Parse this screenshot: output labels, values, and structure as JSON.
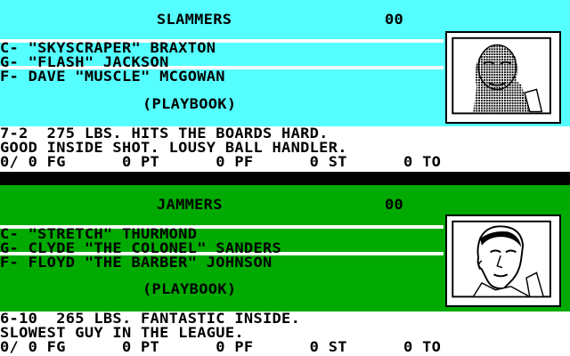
{
  "colors": {
    "team1": "#55ffff",
    "team2": "#00aa00",
    "divider": "#000000",
    "text": "#000000",
    "info_bg": "#ffffff"
  },
  "teams": [
    {
      "name": "SLAMMERS",
      "score": "00",
      "players": [
        "C- \"SKYSCRAPER\" BRAXTON",
        "G- \"FLASH\" JACKSON",
        "F- DAVE \"MUSCLE\" MCGOWAN"
      ],
      "playbook": "(PLAYBOOK)",
      "info": [
        "7-2  275 LBS. HITS THE BOARDS HARD.",
        "GOOD INSIDE SHOT. LOUSY BALL HANDLER."
      ],
      "stats": "0/ 0 FG      0 PT      0 PF      0 ST      0 TO",
      "portrait": "player-portrait-braxton"
    },
    {
      "name": "JAMMERS",
      "score": "00",
      "players": [
        "C- \"STRETCH\" THURMOND",
        "G- CLYDE \"THE COLONEL\" SANDERS",
        "F- FLOYD \"THE BARBER\" JOHNSON"
      ],
      "playbook": "(PLAYBOOK)",
      "info": [
        "6-10  265 LBS. FANTASTIC INSIDE.",
        "SLOWEST GUY IN THE LEAGUE."
      ],
      "stats": "0/ 0 FG      0 PT      0 PF      0 ST      0 TO",
      "portrait": "player-portrait-thurmond"
    }
  ]
}
